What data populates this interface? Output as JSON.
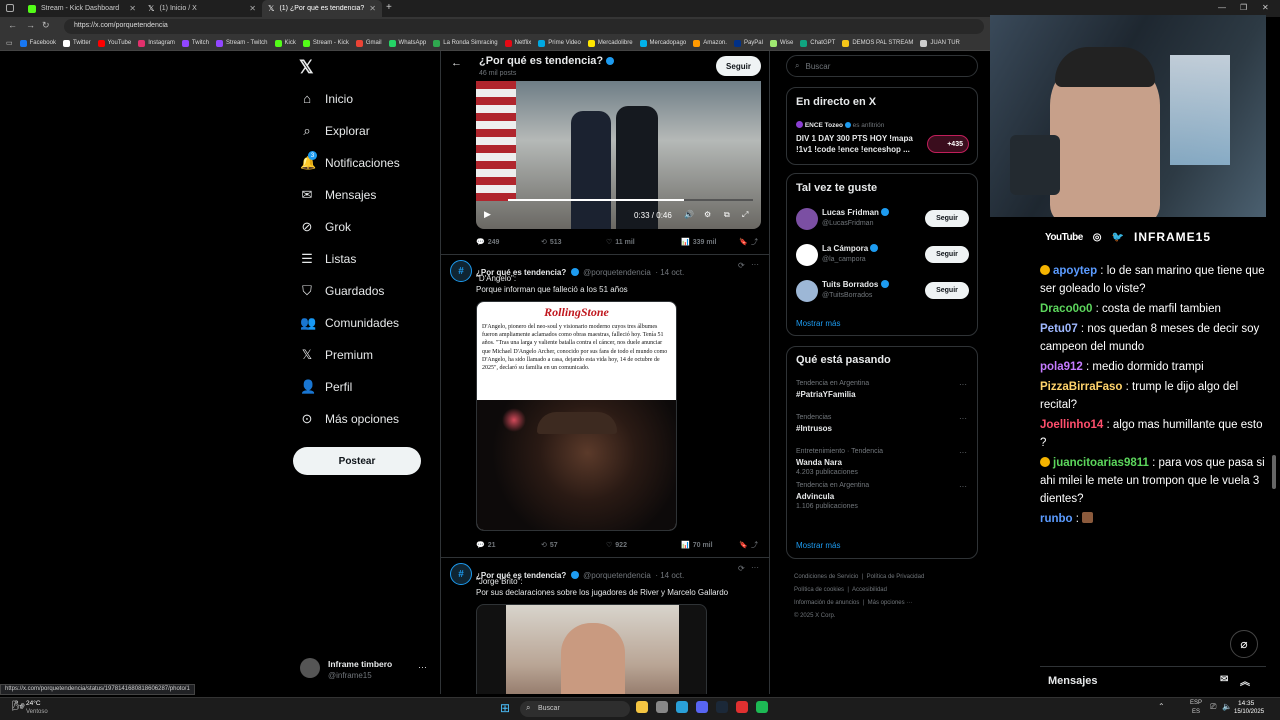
{
  "browser": {
    "tabs": [
      {
        "title": "Stream - Kick Dashboard",
        "color": "#53fc18"
      },
      {
        "title": "(1) Inicio / X",
        "color": "#ffffff"
      },
      {
        "title": "(1) ¿Por qué es tendencia? (@por",
        "color": "#ffffff"
      }
    ],
    "url": "https://x.com/porquetendencia",
    "bookmarks": [
      "Facebook",
      "Twitter",
      "YouTube",
      "Instagram",
      "Twitch",
      "Stream - Twitch",
      "Kick",
      "Stream - Kick",
      "Gmail",
      "WhatsApp",
      "La Ronda Simracing",
      "Netflix",
      "Prime Video",
      "Mercadolibre",
      "Mercadopago",
      "Amazon.",
      "PayPal",
      "Wise",
      "ChatGPT",
      "DEMOS PAL STREAM",
      "JUAN TUR"
    ],
    "status_url": "https://x.com/porquetendencia/status/1978141680818606287/photo/1"
  },
  "nav": {
    "items": [
      "Inicio",
      "Explorar",
      "Notificaciones",
      "Mensajes",
      "Grok",
      "Listas",
      "Guardados",
      "Comunidades",
      "Premium",
      "Perfil",
      "Más opciones"
    ],
    "notif_badge": "3",
    "post_label": "Postear",
    "user_name": "Inframe timbero",
    "user_handle": "@inframe15"
  },
  "header": {
    "title": "¿Por qué es tendencia?",
    "posts_count": "46 mil posts",
    "follow_label": "Seguir"
  },
  "video": {
    "time": "0:33 / 0:46",
    "progress": 0.72
  },
  "tweets": [
    {
      "replies": "249",
      "reposts": "513",
      "likes": "11 mil",
      "views": "339 mil"
    },
    {
      "name": "¿Por qué es tendencia?",
      "handle": "@porquetendencia",
      "date": "· 14 oct.",
      "line1": "\"D'Angelo\":",
      "line2": "Porque informan que falleció a los 51 años",
      "article_logo": "RollingStone",
      "article_text": "D'Angelo, pionero del neo-soul y visionario moderno cuyos tres álbumes fueron ampliamente aclamados como obras maestras, falleció hoy. Tenía 51 años. \"Tras una larga y valiente batalla contra el cáncer, nos duele anunciar que Michael D'Angelo Archer, conocido por sus fans de todo el mundo como D'Angelo, ha sido llamado a casa, dejando esta vida hoy, 14 de octubre de 2025\", declaró su familia en un comunicado.",
      "replies": "21",
      "reposts": "57",
      "likes": "922",
      "views": "70 mil"
    },
    {
      "name": "¿Por qué es tendencia?",
      "handle": "@porquetendencia",
      "date": "· 14 oct.",
      "line1": "\"Jorge Brito\":",
      "line2": "Por sus declaraciones sobre los jugadores de River y Marcelo Gallardo"
    }
  ],
  "search": {
    "placeholder": "Buscar"
  },
  "live": {
    "title": "En directo en X",
    "host": "ENCE Tozeo",
    "host_role": "es anfitrión",
    "line1": "DIV 1 DAY 300 PTS HOY !mapa",
    "line2": "!1v1 !code !ence !enceshop ...",
    "listeners": "+435"
  },
  "who_to_follow": {
    "title": "Tal vez te guste",
    "users": [
      {
        "name": "Lucas Fridman",
        "handle": "@LucasFridman",
        "btn": "Seguir"
      },
      {
        "name": "La Cámpora",
        "handle": "@la_campora",
        "btn": "Seguir"
      },
      {
        "name": "Tuits Borrados",
        "handle": "@TuitsBorrados",
        "btn": "Seguir"
      }
    ],
    "more": "Mostrar más"
  },
  "trends": {
    "title": "Qué está pasando",
    "items": [
      {
        "context": "Tendencia en Argentina",
        "topic": "#PatriaYFamilia",
        "count": ""
      },
      {
        "context": "Tendencias",
        "topic": "#Intrusos",
        "count": ""
      },
      {
        "context": "Entretenimiento · Tendencia",
        "topic": "Wanda Nara",
        "count": "4.203 publicaciones"
      },
      {
        "context": "Tendencia en Argentina",
        "topic": "Advincula",
        "count": "1.106 publicaciones"
      }
    ],
    "more": "Mostrar más"
  },
  "footer": {
    "line1": [
      "Condiciones de Servicio",
      "Política de Privacidad"
    ],
    "line2": [
      "Política de cookies",
      "Accesibilidad"
    ],
    "line3": [
      "Información de anuncios",
      "Más opciones ···"
    ],
    "copyright": "© 2025 X Corp."
  },
  "stream": {
    "social_youtube": "YouTube",
    "brand": "INFRAME15",
    "chat": [
      {
        "user": "apoytep",
        "color": "#5b9bff",
        "text": "lo de san marino que tiene que ser goleado lo viste?"
      },
      {
        "user": "Draco0o0",
        "color": "#5cd65c",
        "text": "costa de marfil tambien"
      },
      {
        "user": "Petu07",
        "color": "#9fb8ff",
        "text": "nos quedan 8 meses de decir soy campeon del mundo"
      },
      {
        "user": "pola912",
        "color": "#c57bff",
        "text": "medio dormido trampi"
      },
      {
        "user": "PizzaBirraFaso",
        "color": "#ffd36b",
        "text": "trump le dijo algo del recital?"
      },
      {
        "user": "Joellinho14",
        "color": "#ff4f6d",
        "text": "algo mas humillante que esto ?"
      },
      {
        "user": "juancitoarias9811",
        "color": "#5cd65c",
        "text": "para vos que pasa si ahi milei le mete un trompon que le vuela 3 dientes?"
      },
      {
        "user": "runbo",
        "color": "#5b9bff",
        "text": ""
      }
    ],
    "messages_label": "Mensajes"
  },
  "taskbar": {
    "weather_temp": "24°C",
    "weather_desc": "Ventoso",
    "search": "Buscar",
    "lang1": "ESP",
    "lang2": "ES",
    "time": "14:35",
    "date": "15/10/2025"
  }
}
